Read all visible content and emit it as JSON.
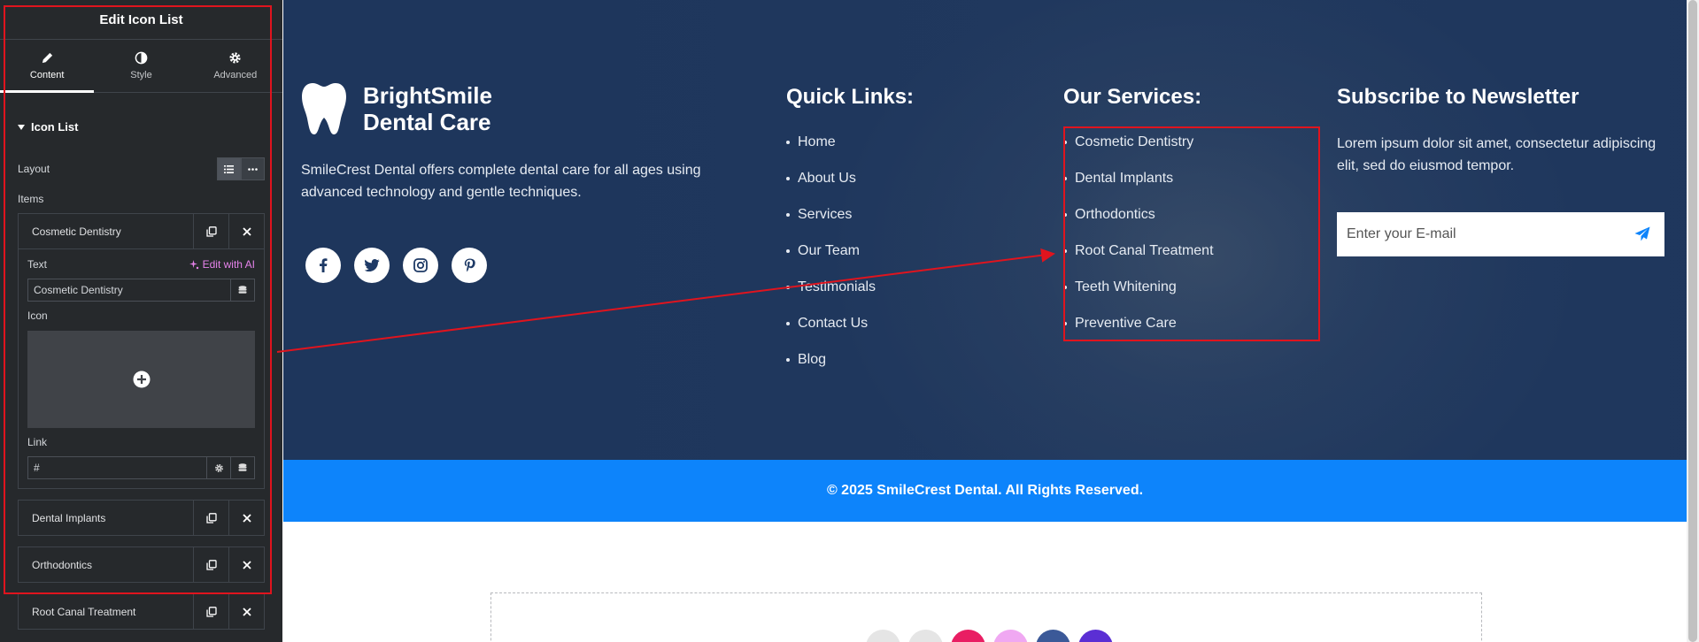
{
  "panel": {
    "title": "Edit Icon List",
    "tabs": [
      {
        "label": "Content",
        "icon": "pencil-icon"
      },
      {
        "label": "Style",
        "icon": "contrast-icon"
      },
      {
        "label": "Advanced",
        "icon": "gear-icon"
      }
    ],
    "section_title": "Icon List",
    "layout_label": "Layout",
    "items_label": "Items",
    "items": [
      {
        "title": "Cosmetic Dentistry"
      },
      {
        "title": "Dental Implants"
      },
      {
        "title": "Orthodontics"
      },
      {
        "title": "Root Canal Treatment"
      }
    ],
    "editor": {
      "text_label": "Text",
      "ai_label": "Edit with AI",
      "text_value": "Cosmetic Dentistry",
      "icon_label": "Icon",
      "link_label": "Link",
      "link_value": "#"
    }
  },
  "footer": {
    "brand_line1": "BrightSmile",
    "brand_line2": "Dental Care",
    "about": "SmileCrest Dental offers complete dental care for all ages using advanced technology and gentle techniques.",
    "socials": [
      "facebook-icon",
      "twitter-icon",
      "instagram-icon",
      "pinterest-icon"
    ],
    "quick_links_title": "Quick Links:",
    "quick_links": [
      "Home",
      "About Us",
      "Services",
      "Our Team",
      "Testimonials",
      "Contact Us",
      "Blog"
    ],
    "services_title": "Our Services:",
    "services": [
      "Cosmetic Dentistry",
      "Dental Implants",
      "Orthodontics",
      "Root Canal Treatment",
      "Teeth Whitening",
      "Preventive Care"
    ],
    "newsletter_title": "Subscribe to Newsletter",
    "newsletter_text": "Lorem ipsum dolor sit amet, consectetur adipiscing elit, sed do eiusmod tempor.",
    "email_placeholder": "Enter your E-mail"
  },
  "copyright": "© 2025 SmileCrest Dental. All Rights Reserved.",
  "colors": {
    "panel_bg": "#26292c",
    "accent_blue": "#0d84fb",
    "highlight_red": "#e0141e",
    "ai_pink": "#e582ea",
    "drop_icons": [
      "#e5e5e5",
      "#e5e5e5",
      "#e91e63",
      "#f0a8f2",
      "#3b5998",
      "#5b2fd4"
    ]
  }
}
